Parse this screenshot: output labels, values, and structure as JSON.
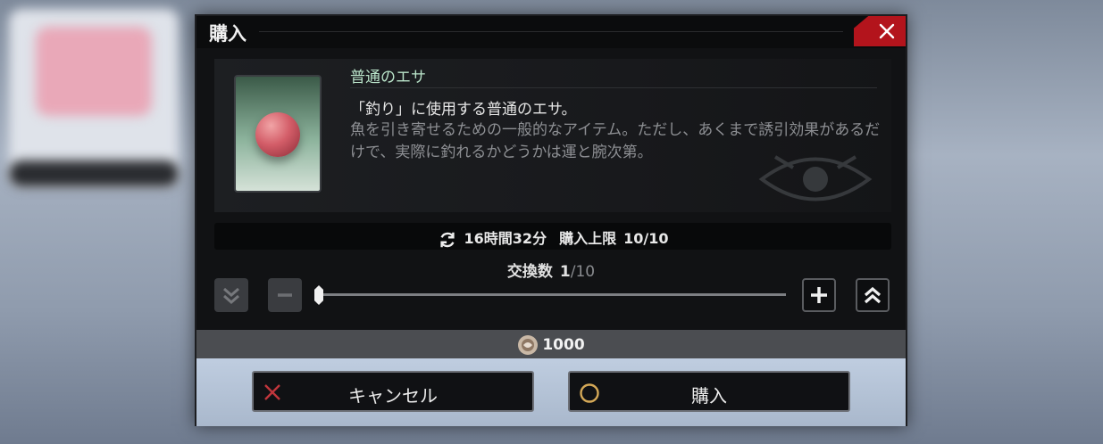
{
  "dialog": {
    "title": "購入",
    "close_icon": "close-icon"
  },
  "item": {
    "name": "普通のエサ",
    "description_main": "「釣り」に使用する普通のエサ。",
    "description_detail": "魚を引き寄せるための一般的なアイテム。ただし、あくまで誘引効果があるだけで、実際に釣れるかどうかは運と腕次第。"
  },
  "limit": {
    "refresh_icon": "refresh-icon",
    "timer": "16時間32分",
    "label": "購入上限",
    "value": "10/10"
  },
  "exchange": {
    "label": "交換数",
    "current": "1",
    "max": "/10",
    "slider_fraction": 0.0
  },
  "cost": {
    "icon": "bait-coin-icon",
    "amount": "1000"
  },
  "buttons": {
    "cancel_label": "キャンセル",
    "buy_label": "購入"
  },
  "colors": {
    "close_bg": "#b3141c",
    "item_name": "#b9e3c9",
    "cancel_icon": "#c0363c",
    "confirm_icon": "#d4a857"
  }
}
